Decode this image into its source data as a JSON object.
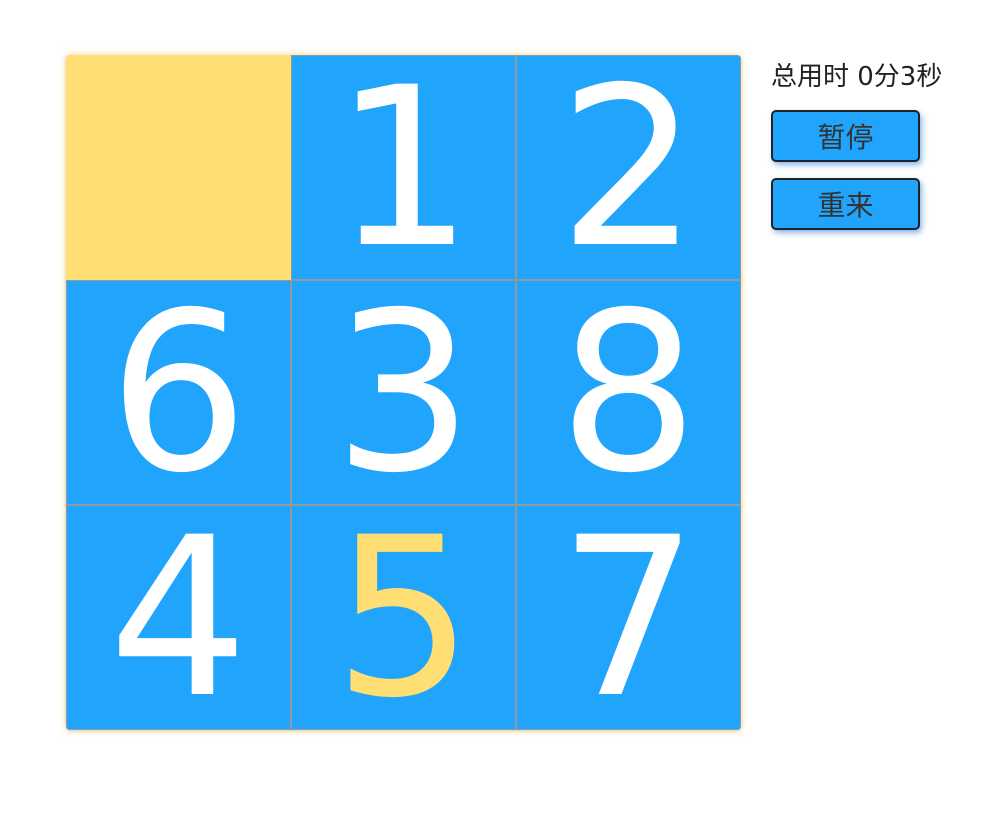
{
  "board": {
    "tiles": [
      "",
      "1",
      "2",
      "6",
      "3",
      "8",
      "4",
      "5",
      "7"
    ],
    "correct_tiles": [
      "5"
    ],
    "colors": {
      "tile": "#21a4fb",
      "empty": "#ffdf73",
      "number": "#ffffff",
      "correct_number": "#ffdf73"
    }
  },
  "sidebar": {
    "timer_text": "总用时 0分3秒",
    "pause_label": "暂停",
    "restart_label": "重来"
  }
}
